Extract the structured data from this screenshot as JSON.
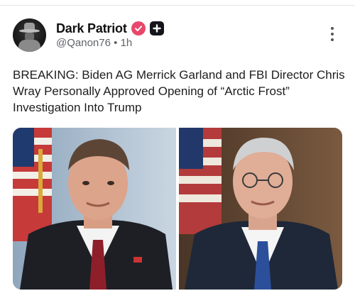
{
  "post": {
    "author": {
      "display_name": "Dark Patriot",
      "handle": "@Qanon76",
      "separator": "•",
      "time_ago": "1h",
      "avatar_icon": "hooded-figure-avatar",
      "verified_icon": "verified-check-icon",
      "badge_icon": "plus-badge-icon"
    },
    "text": "BREAKING: Biden AG Merrick Garland and FBI Director Chris Wray Personally Approved Opening of “Arctic Frost” Investigation Into Trump",
    "menu_icon": "more-vertical-icon",
    "images": [
      {
        "name": "photo-man-red-tie"
      },
      {
        "name": "photo-man-blue-tie"
      }
    ]
  },
  "colors": {
    "verified": "#e8476b",
    "plus_badge": "#14151a",
    "handle_text": "#5f6368"
  }
}
